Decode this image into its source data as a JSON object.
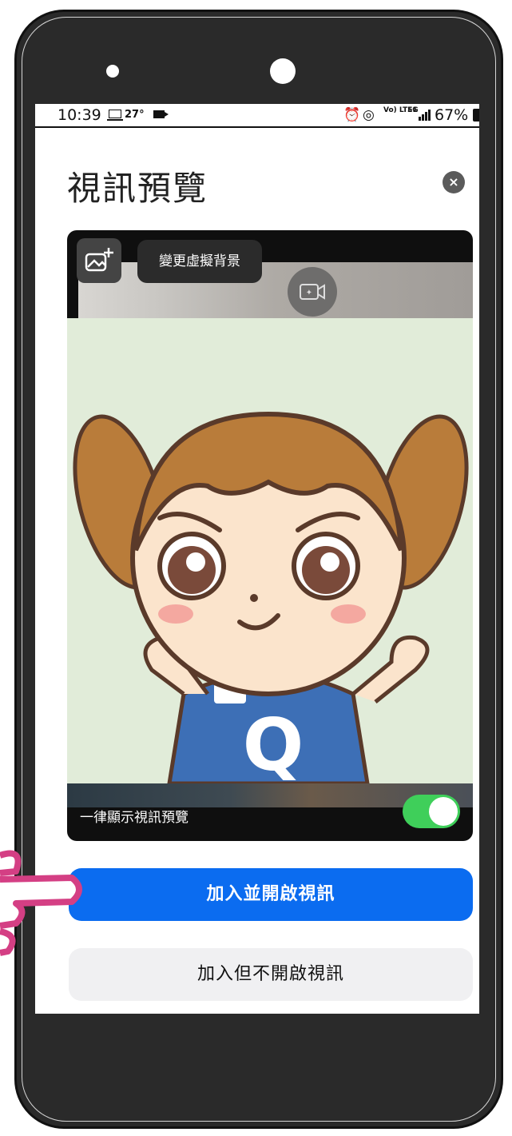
{
  "status_bar": {
    "time": "10:39",
    "temperature": "27°",
    "volte": "Vo) LTE1",
    "network": "5G",
    "battery": "67%"
  },
  "dialog": {
    "title": "視訊預覽",
    "close_icon": "×"
  },
  "preview": {
    "change_background_tooltip": "變更虛擬背景",
    "always_show_label": "一律顯示視訊預覽",
    "always_show_enabled": true,
    "shirt_letter": "Q"
  },
  "actions": {
    "join_with_video": "加入並開啟視訊",
    "join_without_video": "加入但不開啟視訊"
  },
  "colors": {
    "primary": "#0b6cf0",
    "toggle_on": "#3fcf5a",
    "avatar_background": "#e1ecd9"
  }
}
